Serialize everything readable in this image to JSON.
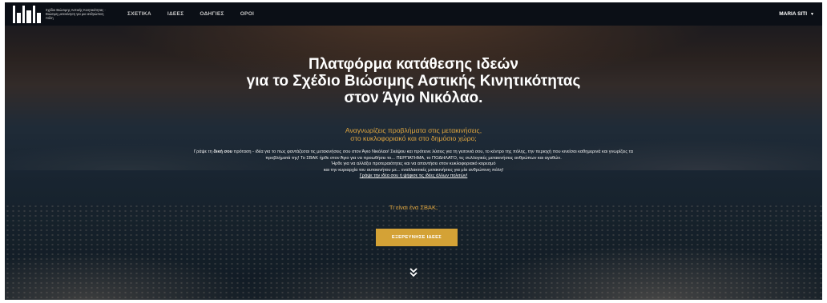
{
  "nav": {
    "logo_text": "Σχέδιο Βιώσιμης Αστικής Κινητικότητας · Βιώσιμη μετακίνηση για μια ανθρώπινη πόλη",
    "links": [
      "ΣΧΕΤΙΚΑ",
      "ΙΔΕΕΣ",
      "ΟΔΗΓΙΕΣ",
      "ΟΡΟΙ"
    ],
    "user": "MARIA SITI"
  },
  "hero": {
    "title_lines": [
      "Πλατφόρμα κατάθεσης ιδεών",
      "για το Σχέδιο Βιώσιμης Αστικής Κινητικότητας",
      "στον Άγιο Νικόλαο."
    ],
    "subtitle_lines": [
      "Αναγνωρίζεις προβλήματα στις μετακινήσεις,",
      "στο κυκλοφοριακό και στο δημόσιο χώρο;"
    ],
    "body": {
      "p1_prefix": "Γράψε τη ",
      "p1_bold": "δική σου",
      "p1_rest": " πρόταση - ιδέα για το πως φαντάζεσαι τις μετακινήσεις σου στον Άγιο Νικόλαο! Σκέψου και πρότεινε λύσεις για τη γειτονιά σου, το κέντρο της πόλης, την περιοχή που κινείσαι καθημερινά και γνωρίζεις τα προβλήματά της! Το ΣΒΑΚ ήρθε στον Άγιο για να προωθήσει το... ΠΕΡΠΑΤΗΜΑ, το ΠΟΔΗΛΑΤΟ, τις συλλογικές μετακινήσεις ανθρώπων και αγαθών.",
      "line2": "Ήρθε για να αλλάξει προτεραιότητες και να απαντήσει στον κυκλοφοριακό κορεσμό",
      "line3": "και την κυριαρχία του αυτοκινήτου με... εναλλακτικές μετακινήσεις για μία ανθρώπινη πόλη!",
      "cta": "Γράψε την ιδέα σου ή ψήφισε τις ιδέες άλλων πολιτών!"
    },
    "what_is_link": "Τι είναι ένα ΣΒΑΚ;",
    "explore_button": "ΕΞΕΡΕΥΝΗΣΕ ΙΔΕΕΣ",
    "scroll_icon": "double-chevron-down-icon"
  },
  "colors": {
    "accent": "#e0a63f",
    "button": "#d4a236",
    "navbar": "#0b0f16"
  }
}
